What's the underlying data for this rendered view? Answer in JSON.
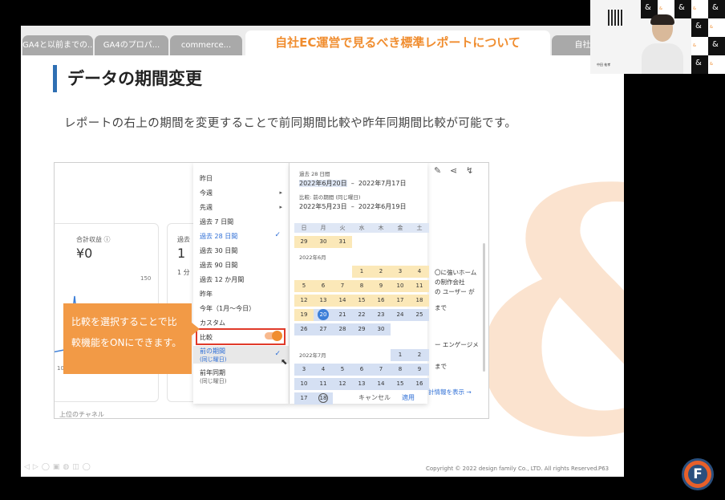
{
  "tabs": [
    {
      "label": "GA4と以前までの..."
    },
    {
      "label": "GA4のプロパ..."
    },
    {
      "label": "commerce..."
    },
    {
      "label": "自社EC運営で見るべき標準レポートについて"
    },
    {
      "label": "自社EC"
    }
  ],
  "slide": {
    "title": "データの期間変更",
    "description": "レポートの右上の期間を変更することで前同期間比較や昨年同期間比較が可能です。",
    "copyright": "Copyright © 2022 design family Co., LTD. All rights Reserved.",
    "page": "P63"
  },
  "cards": {
    "revenue_label": "合計収益",
    "revenue_value": "¥0",
    "second_label": "過去",
    "second_value": "1",
    "second_sub": "1 分",
    "scale_150": "150",
    "scale_10": "10",
    "bottom_label": "上位のチャネル"
  },
  "menu": {
    "items": [
      {
        "label": "昨日"
      },
      {
        "label": "今週",
        "arrow": "▸"
      },
      {
        "label": "先週",
        "arrow": "▸"
      },
      {
        "label": "過去 7 日間"
      },
      {
        "label": "過去 28 日間",
        "check": "✓"
      },
      {
        "label": "過去 30 日間"
      },
      {
        "label": "過去 90 日間"
      },
      {
        "label": "過去 12 か月間"
      },
      {
        "label": "昨年"
      },
      {
        "label": "今年（1月〜今日）"
      },
      {
        "label": "カスタム"
      }
    ],
    "compare_label": "比較",
    "prev_period_label": "前の期間",
    "prev_period_sub": "(同じ曜日)",
    "prev_year_label": "前年同期",
    "prev_year_sub": "(同じ曜日)",
    "prev_check": "✓"
  },
  "calendar": {
    "period_label": "過去 28 日間",
    "range_start": "2022年6月20日",
    "range_sep": "–",
    "range_end": "2022年7月17日",
    "compare_label": "比較: 前の期間 (同じ曜日)",
    "cmp_start": "2022年5月23日",
    "cmp_sep": "–",
    "cmp_end": "2022年6月19日",
    "dow": [
      "日",
      "月",
      "火",
      "水",
      "木",
      "金",
      "土"
    ],
    "may_tail": [
      "29",
      "30",
      "31"
    ],
    "june_label": "2022年6月",
    "july_label": "2022年7月",
    "june_rows": [
      [
        "",
        "",
        "",
        "1",
        "2",
        "3",
        "4"
      ],
      [
        "5",
        "6",
        "7",
        "8",
        "9",
        "10",
        "11"
      ],
      [
        "12",
        "13",
        "14",
        "15",
        "16",
        "17",
        "18"
      ],
      [
        "19",
        "20",
        "21",
        "22",
        "23",
        "24",
        "25"
      ],
      [
        "26",
        "27",
        "28",
        "29",
        "30",
        "",
        ""
      ]
    ],
    "july_rows": [
      [
        "",
        "",
        "",
        "",
        "",
        "1",
        "2"
      ],
      [
        "3",
        "4",
        "5",
        "6",
        "7",
        "8",
        "9"
      ],
      [
        "10",
        "11",
        "12",
        "13",
        "14",
        "15",
        "16"
      ],
      [
        "17",
        "18",
        "",
        "",
        "",
        "",
        ""
      ]
    ],
    "cancel": "キャンセル",
    "apply": "適用"
  },
  "right_panel": {
    "line1": "〇に強いホーム",
    "line2": "の制作会社",
    "line3": "の ユーザー が",
    "line4": "まで",
    "line5": "ー エンゲージメ",
    "line6": "まで",
    "link": "計情報を表示 →"
  },
  "callout": {
    "text": "比較を選択することで比較機能をONにできます。"
  },
  "webcam": {
    "name": "中田 祐孝",
    "badge": "&"
  },
  "logo": {
    "letter": "F"
  },
  "colors": {
    "accent_orange": "#f08d2f",
    "callout_orange": "#f29a46",
    "highlight_red": "#e03a2a",
    "ga_blue": "#3d7fd8",
    "title_bar_blue": "#2f6fb3"
  }
}
